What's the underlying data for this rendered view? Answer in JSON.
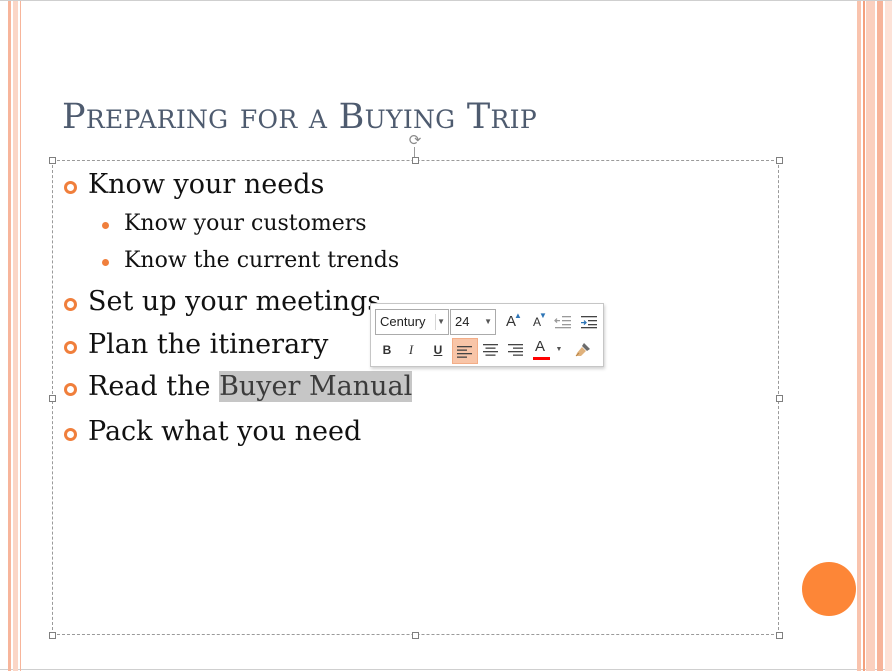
{
  "slide": {
    "title": "Preparing for a Buying Trip",
    "bullets": [
      {
        "level": 1,
        "text": "Know your needs"
      },
      {
        "level": 2,
        "text": "Know your customers"
      },
      {
        "level": 2,
        "text": "Know the current trends"
      },
      {
        "level": 1,
        "text": "Set up your meetings"
      },
      {
        "level": 1,
        "text": "Plan the itinerary"
      },
      {
        "level": 1,
        "text_before": "Read the ",
        "text_selected": "Buyer Manual"
      },
      {
        "level": 1,
        "text": "Pack what you need"
      }
    ]
  },
  "mini_toolbar": {
    "font_name": "Century",
    "font_size": "24",
    "buttons": {
      "grow_font": "A",
      "shrink_font": "A",
      "bold": "B",
      "italic": "I",
      "underline": "U",
      "font_color": "A"
    },
    "font_color_bar": "#ff0000"
  },
  "colors": {
    "title": "#4e5b6f",
    "bullet_accent": "#f07f3c",
    "selection": "#c6c6c6",
    "active_button": "#f8c5a8",
    "decor_circle": "#fd8637"
  }
}
